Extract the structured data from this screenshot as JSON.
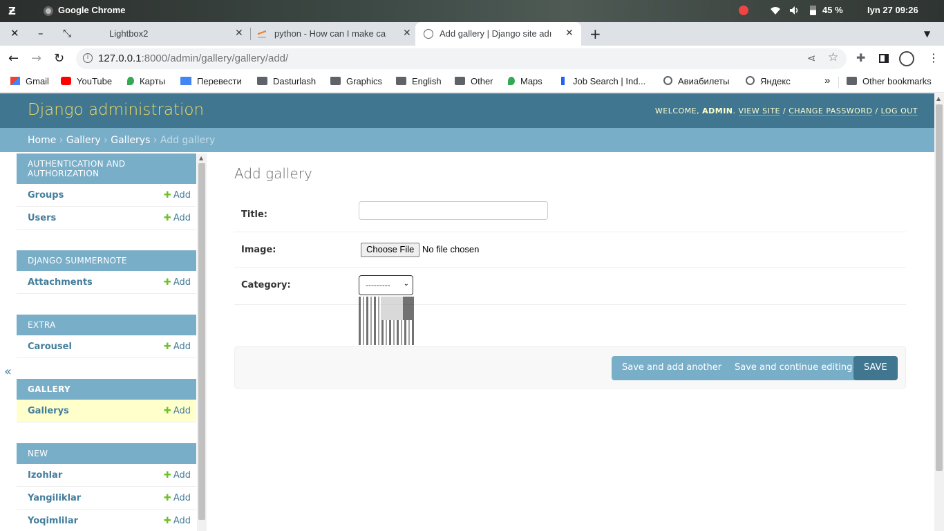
{
  "os": {
    "activities": "Ƶ",
    "app_name": "Google Chrome",
    "battery": "45 %",
    "datetime": "Iyn 27  09:26"
  },
  "browser": {
    "tabs": [
      {
        "title": "Lightbox2"
      },
      {
        "title": "python - How can I make ca"
      },
      {
        "title": "Add gallery | Django site adı"
      }
    ],
    "url_host": "127.0.0.1",
    "url_rest": ":8000/admin/gallery/gallery/add/",
    "bookmarks": [
      {
        "label": "Gmail",
        "icon": "gmail-icon"
      },
      {
        "label": "YouTube",
        "icon": "youtube-icon"
      },
      {
        "label": "Карты",
        "icon": "maps-pin-icon"
      },
      {
        "label": "Перевести",
        "icon": "translate-icon"
      },
      {
        "label": "Dasturlash",
        "icon": "folder-icon"
      },
      {
        "label": "Graphics",
        "icon": "folder-icon"
      },
      {
        "label": "English",
        "icon": "folder-icon"
      },
      {
        "label": "Other",
        "icon": "folder-icon"
      },
      {
        "label": "Maps",
        "icon": "maps-pin-icon"
      },
      {
        "label": "Job Search | Ind...",
        "icon": "indeed-icon"
      },
      {
        "label": "Авиабилеты",
        "icon": "globe-icon"
      },
      {
        "label": "Яндекс",
        "icon": "globe-icon"
      }
    ],
    "more_bookmarks": "»",
    "other_bookmarks": "Other bookmarks"
  },
  "django": {
    "branding": "Django administration",
    "welcome": "Welcome,",
    "user": "admin",
    "view_site": "View site",
    "change_password": "Change password",
    "log_out": "Log out",
    "breadcrumbs": {
      "home": "Home",
      "app": "Gallery",
      "model": "Gallerys",
      "current": "Add gallery"
    },
    "add_label": "Add",
    "collapse": "«",
    "sidebar": [
      {
        "caption": "Authentication and Authorization",
        "models": [
          "Groups",
          "Users"
        ]
      },
      {
        "caption": "Django Summernote",
        "models": [
          "Attachments"
        ]
      },
      {
        "caption": "Extra",
        "models": [
          "Carousel"
        ]
      },
      {
        "caption": "Gallery",
        "models": [
          "Gallerys"
        ]
      },
      {
        "caption": "New",
        "models": [
          "Izohlar",
          "Yangiliklar",
          "Yoqimlilar"
        ]
      }
    ],
    "form": {
      "heading": "Add gallery",
      "title_label": "Title:",
      "title_value": "",
      "image_label": "Image:",
      "choose_file": "Choose File",
      "no_file": "No file chosen",
      "category_label": "Category:",
      "category_selected": "---------"
    },
    "buttons": {
      "save_add_another": "Save and add another",
      "save_continue": "Save and continue editing",
      "save": "SAVE"
    }
  }
}
